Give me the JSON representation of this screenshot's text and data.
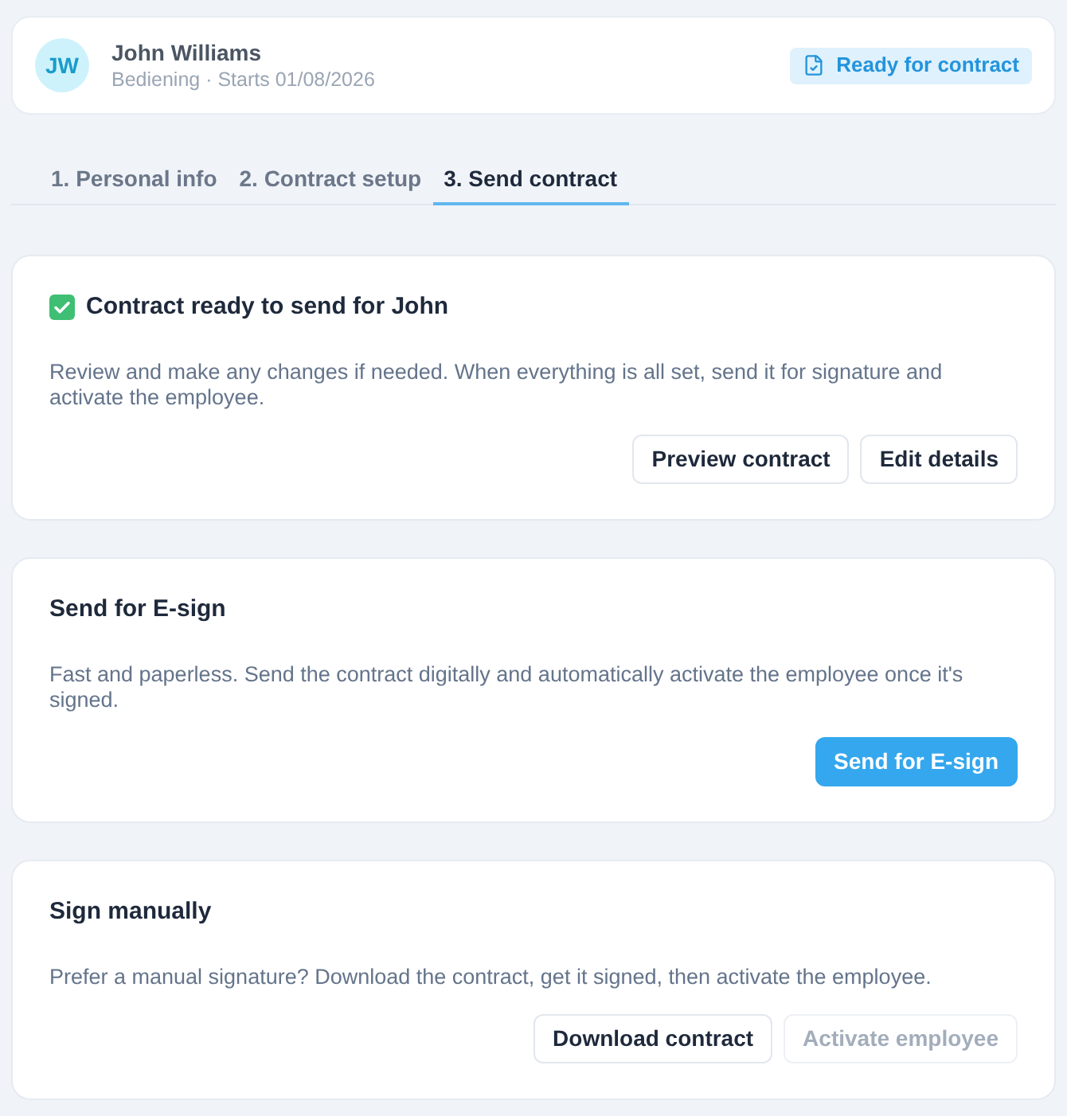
{
  "header": {
    "avatar_initials": "JW",
    "name": "John Williams",
    "subtitle": "Bediening · Starts 01/08/2026",
    "badge": "Ready for contract"
  },
  "tabs": [
    {
      "label": "1. Personal info",
      "selected": false
    },
    {
      "label": "2. Contract setup",
      "selected": false
    },
    {
      "label": "3. Send contract",
      "selected": true
    }
  ],
  "cards": [
    {
      "kind": "ready",
      "title": "Contract ready to send for John",
      "description": "Review and make any changes if needed. When everything is all set, send it for signature and activate the employee.",
      "buttons": [
        {
          "label": "Preview contract",
          "kind": "outline",
          "disabled": false
        },
        {
          "label": "Edit details",
          "kind": "outline",
          "disabled": false
        }
      ]
    },
    {
      "kind": "plain",
      "title": "Send for E-sign",
      "description": "Fast and paperless. Send the contract digitally and automatically activate the employee once it's signed.",
      "buttons": [
        {
          "label": "Send for E-sign",
          "kind": "primary",
          "disabled": false
        }
      ]
    },
    {
      "kind": "plain",
      "title": "Sign manually",
      "description": "Prefer a manual signature? Download the contract, get it signed, then activate the employee.",
      "buttons": [
        {
          "label": "Download contract",
          "kind": "outline",
          "disabled": false
        },
        {
          "label": "Activate employee",
          "kind": "outline",
          "disabled": true
        }
      ]
    }
  ]
}
